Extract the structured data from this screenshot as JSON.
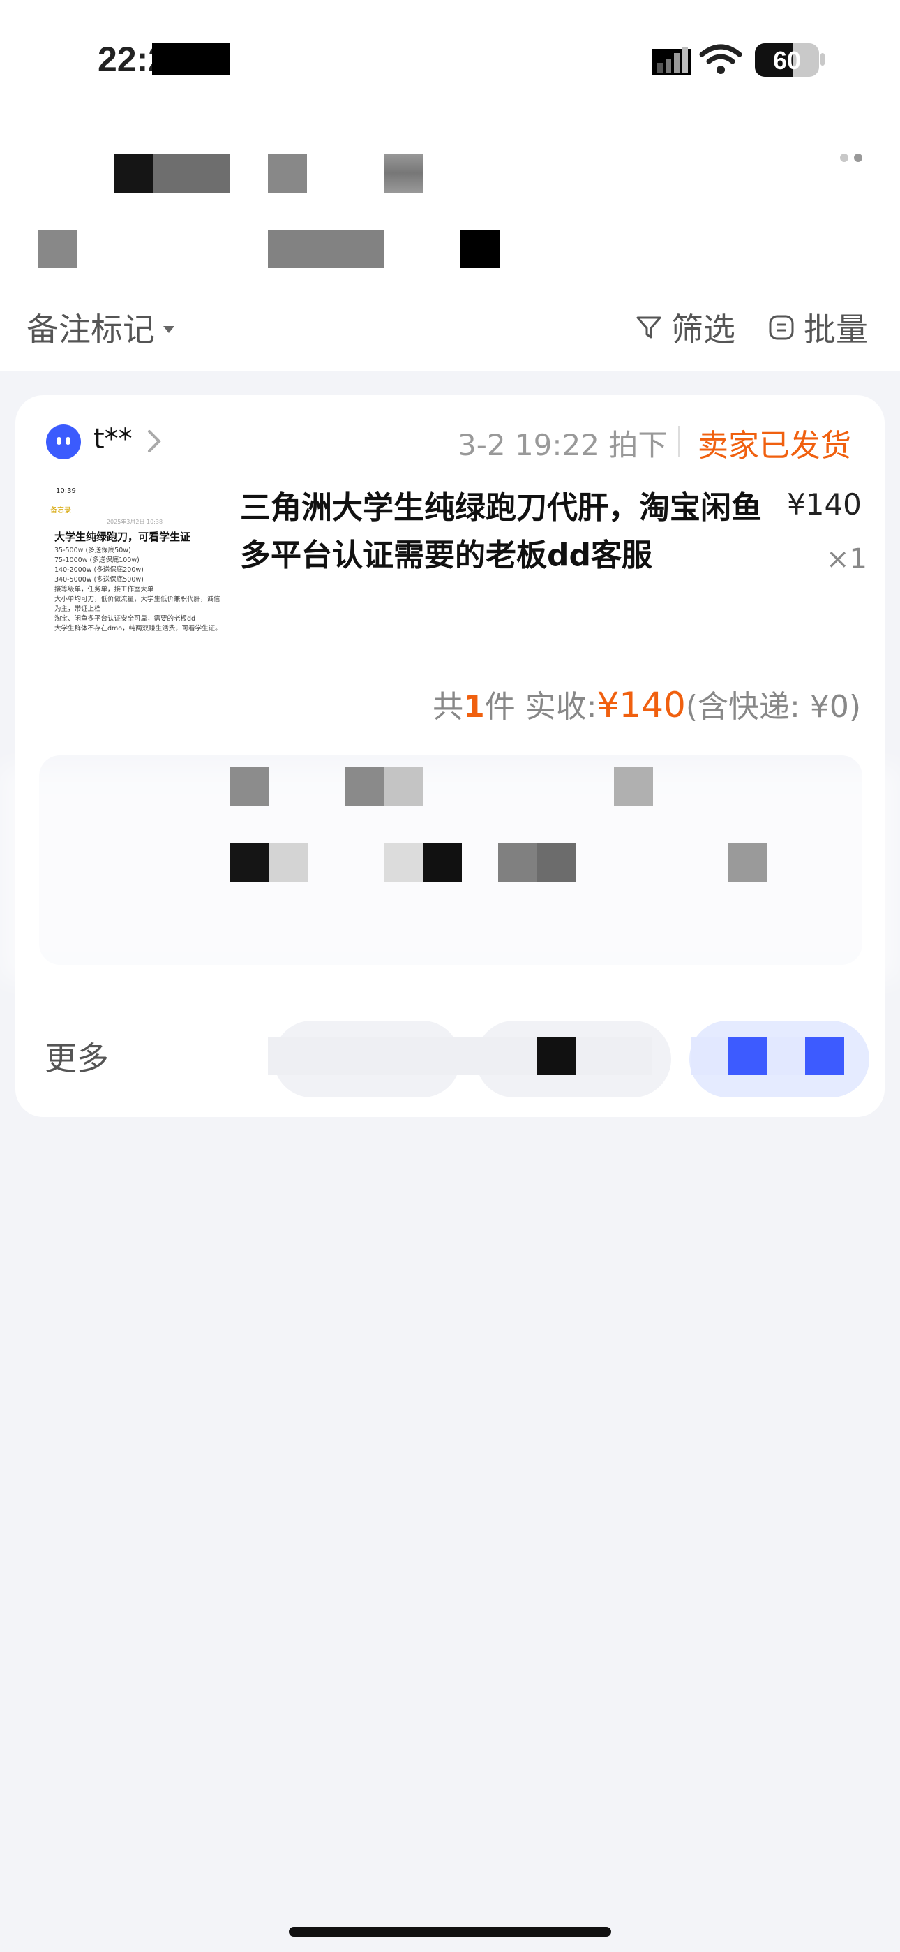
{
  "status_bar": {
    "time": "22:27",
    "battery": "60",
    "battery_level_percent": 60
  },
  "toolbar": {
    "remark_label": "备注标记",
    "filter_label": "筛选",
    "batch_label": "批量"
  },
  "order": {
    "buyer_name": "t**",
    "order_time": "3-2 19:22 拍下",
    "status": "卖家已发货",
    "product_title": "三角洲大学生纯绿跑刀代肝，淘宝闲鱼多平台认证需要的老板dd客服",
    "price": "¥140",
    "quantity": "×1",
    "total_prefix": "共 ",
    "total_count": "1",
    "total_mid": " 件  实收: ",
    "total_amount": "¥140",
    "total_suffix": "(含快递: ¥0)",
    "more_label": "更多"
  },
  "thumbnail": {
    "status_time": "10:39",
    "back_label": "备忘录",
    "date": "2025年3月2日 10:38",
    "title": "大学生纯绿跑刀，可看学生证",
    "lines": [
      "35-500w (多送保底50w)",
      "75-1000w (多送保底100w)",
      "140-2000w (多送保底200w)",
      "340-5000w (多送保底500w)",
      "接等级单，任务单，接工作室大单",
      "大小单均可刀，低价做流量，大学生低价兼职代肝，诚信为主，带证上档",
      "淘宝、闲鱼多平台认证安全可靠，需要的老板dd",
      "大学生群体不存在dmo，纯两双赚生活费，可看学生证。"
    ]
  },
  "colors": {
    "accent_orange": "#f0600f",
    "brand_blue": "#3b5bfd",
    "page_bg": "#f3f4f8"
  }
}
